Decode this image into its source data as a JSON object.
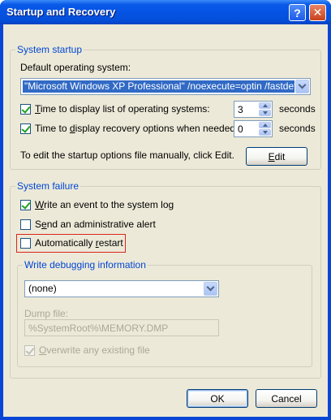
{
  "window": {
    "title": "Startup and Recovery"
  },
  "startup": {
    "group_label": "System startup",
    "default_os_label": "Default operating system:",
    "default_os_value": "\"Microsoft Windows XP Professional\" /noexecute=optin /fastdetect",
    "time_list_label_pre": "",
    "time_list_mnemonic": "T",
    "time_list_label_post": "ime to display list of operating systems:",
    "time_list_checked": true,
    "time_list_value": "3",
    "time_list_unit": "seconds",
    "time_recovery_label_pre": "Time to ",
    "time_recovery_mnemonic": "d",
    "time_recovery_label_post": "isplay recovery options when needed:",
    "time_recovery_checked": true,
    "time_recovery_value": "0",
    "time_recovery_unit": "seconds",
    "edit_hint": "To edit the startup options file manually, click Edit.",
    "edit_button_mnemonic": "E",
    "edit_button_rest": "dit"
  },
  "failure": {
    "group_label": "System failure",
    "write_event_mnemonic": "W",
    "write_event_rest": "rite an event to the system log",
    "write_event_checked": true,
    "admin_alert_pre": "S",
    "admin_alert_mnemonic": "e",
    "admin_alert_post": "nd an administrative alert",
    "admin_alert_checked": false,
    "auto_restart_pre": "Automatically ",
    "auto_restart_mnemonic": "r",
    "auto_restart_post": "estart",
    "auto_restart_checked": false,
    "debug_group_label": "Write debugging information",
    "debug_value": "(none)",
    "dump_file_label": "Dump file:",
    "dump_file_value": "%SystemRoot%\\MEMORY.DMP",
    "overwrite_mnemonic": "O",
    "overwrite_rest": "verwrite any existing file",
    "overwrite_checked": true
  },
  "buttons": {
    "ok": "OK",
    "cancel": "Cancel"
  },
  "colors": {
    "accent": "#0046d5",
    "highlight_box": "#d9261c",
    "selection": "#316ac5"
  }
}
